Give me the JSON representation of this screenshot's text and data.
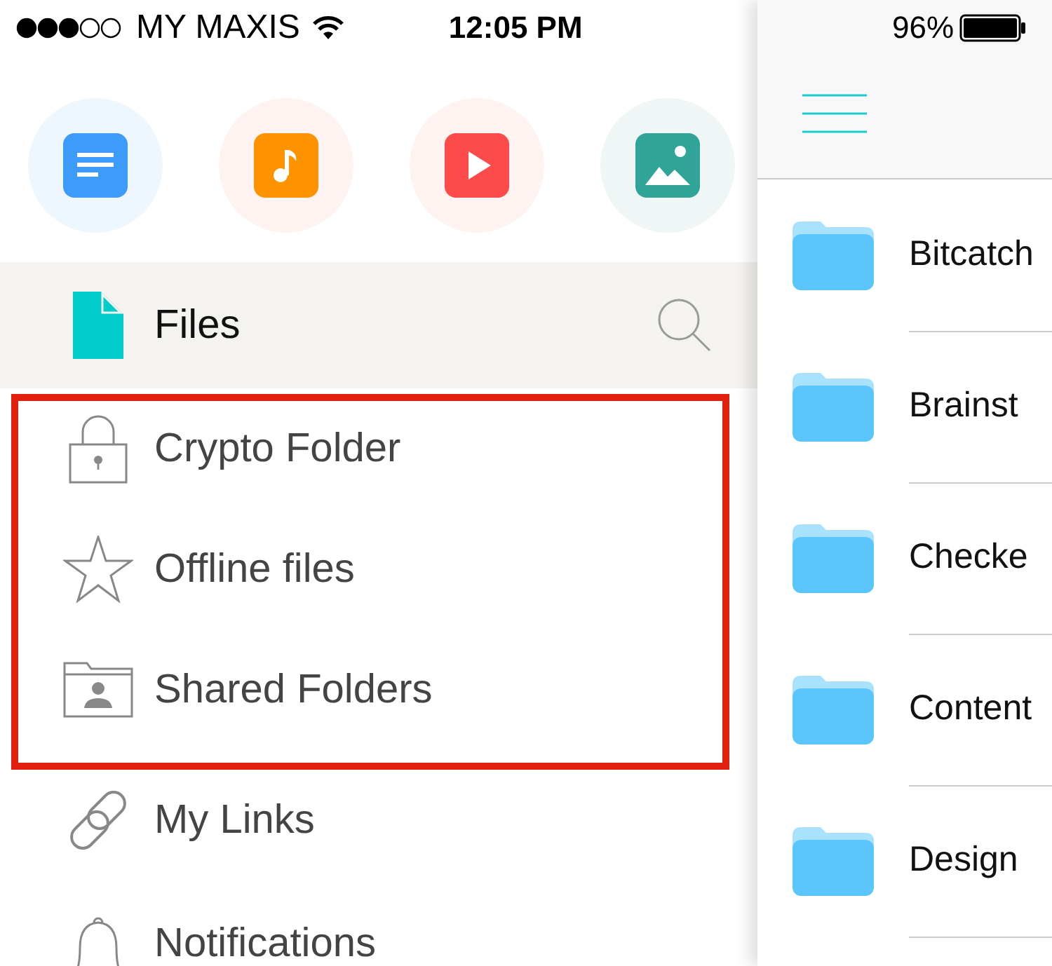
{
  "status_bar": {
    "carrier": "MY MAXIS",
    "time": "12:05 PM",
    "battery": "96%"
  },
  "quick_filters": [
    {
      "kind": "document",
      "color": "#3d9bfa"
    },
    {
      "kind": "music",
      "color": "#fe9300"
    },
    {
      "kind": "video",
      "color": "#fd4b4b"
    },
    {
      "kind": "image",
      "color": "#30a597"
    }
  ],
  "menu": [
    {
      "label": "Files",
      "kind": "file",
      "selected": true,
      "highlighted": false
    },
    {
      "label": "Crypto Folder",
      "kind": "lock",
      "selected": false,
      "highlighted": true
    },
    {
      "label": "Offline files",
      "kind": "star",
      "selected": false,
      "highlighted": true
    },
    {
      "label": "Shared Folders",
      "kind": "shared-folder",
      "selected": false,
      "highlighted": true
    },
    {
      "label": "My Links",
      "kind": "link",
      "selected": false,
      "highlighted": false
    },
    {
      "label": "Notifications",
      "kind": "bell",
      "selected": false,
      "highlighted": false
    }
  ],
  "folders": [
    {
      "name": "Bitcatch"
    },
    {
      "name": "Brainst"
    },
    {
      "name": "Checke"
    },
    {
      "name": "Content"
    },
    {
      "name": "Design"
    }
  ]
}
